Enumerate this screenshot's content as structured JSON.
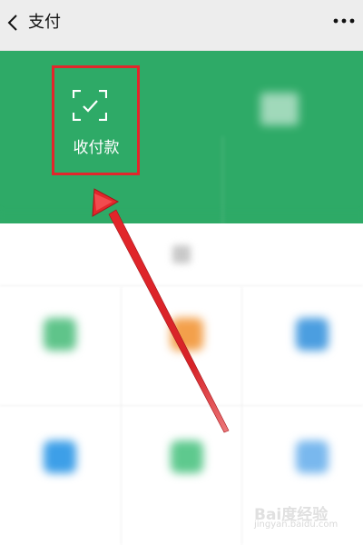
{
  "header": {
    "title": "支付",
    "back_icon": "chevron-left-icon",
    "more_icon": "more-dots-icon"
  },
  "green_panel": {
    "color": "#2eaa67",
    "primary_action": {
      "label": "收付款",
      "icon": "scan-check-icon"
    },
    "secondary_action": {
      "icon": "wallet-icon"
    }
  },
  "annotation": {
    "highlight_color": "#e3262b",
    "arrow_color": "#e3262b"
  },
  "watermark": {
    "logo": "Bai度经验",
    "url": "jingyan.baidu.com"
  }
}
